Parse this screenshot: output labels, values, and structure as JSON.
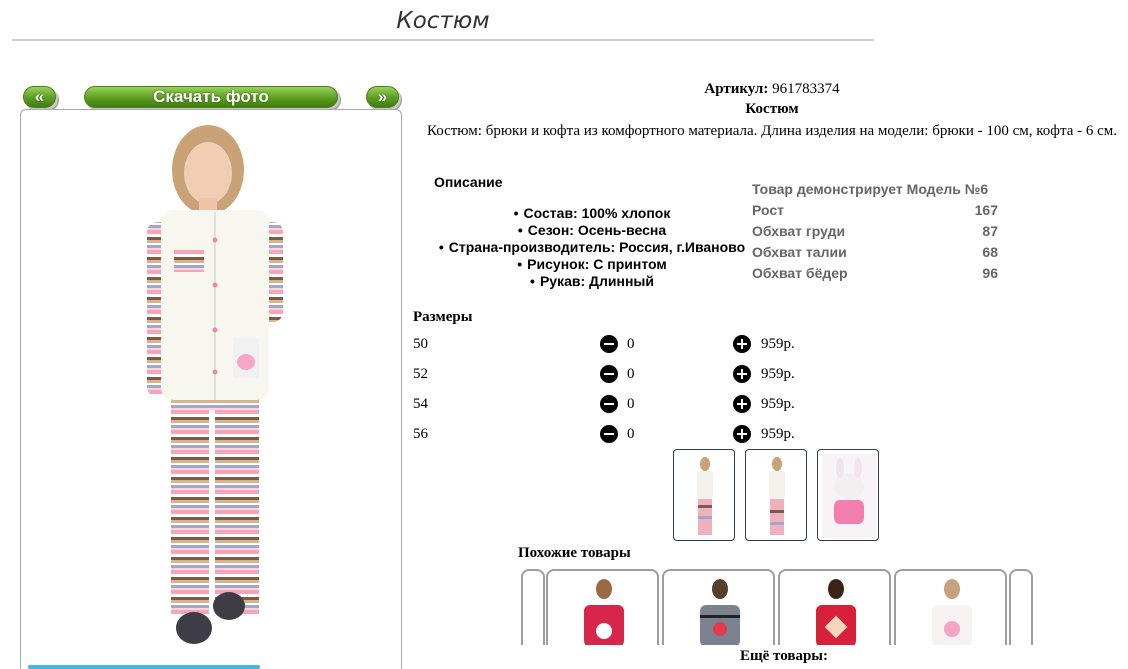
{
  "page": {
    "title": "Костюм"
  },
  "gallery": {
    "prev_label": "«",
    "download_label": "Скачать фото",
    "next_label": "»"
  },
  "product": {
    "article_label": "Артикул:",
    "article_value": "961783374",
    "name": "Костюм",
    "description": "Костюм: брюки и кофта из комфортного материала. Длина изделия на модели: брюки - 100 см, кофта - 6 см."
  },
  "description": {
    "title": "Описание",
    "items": [
      "Состав: 100% хлопок",
      "Сезон: Осень-весна",
      "Страна-производитель: Россия, г.Иваново",
      "Рисунок: С принтом",
      "Рукав: Длинный"
    ]
  },
  "model": {
    "title": "Товар демонстрирует Модель №6",
    "rows": [
      {
        "label": "Рост",
        "value": "167"
      },
      {
        "label": "Обхват груди",
        "value": "87"
      },
      {
        "label": "Обхват талии",
        "value": "68"
      },
      {
        "label": "Обхват бёдер",
        "value": "96"
      }
    ]
  },
  "sizes": {
    "title": "Размеры",
    "rows": [
      {
        "size": "50",
        "qty": "0",
        "price": "959р."
      },
      {
        "size": "52",
        "qty": "0",
        "price": "959р."
      },
      {
        "size": "54",
        "qty": "0",
        "price": "959р."
      },
      {
        "size": "56",
        "qty": "0",
        "price": "959р."
      }
    ]
  },
  "similar": {
    "title": "Похожие товары"
  },
  "more": {
    "title": "Ещё товары:"
  },
  "colors": {
    "accent_green": "#5c9e21",
    "bottom_bar": "#46b3e6",
    "model_text": "#666666"
  }
}
